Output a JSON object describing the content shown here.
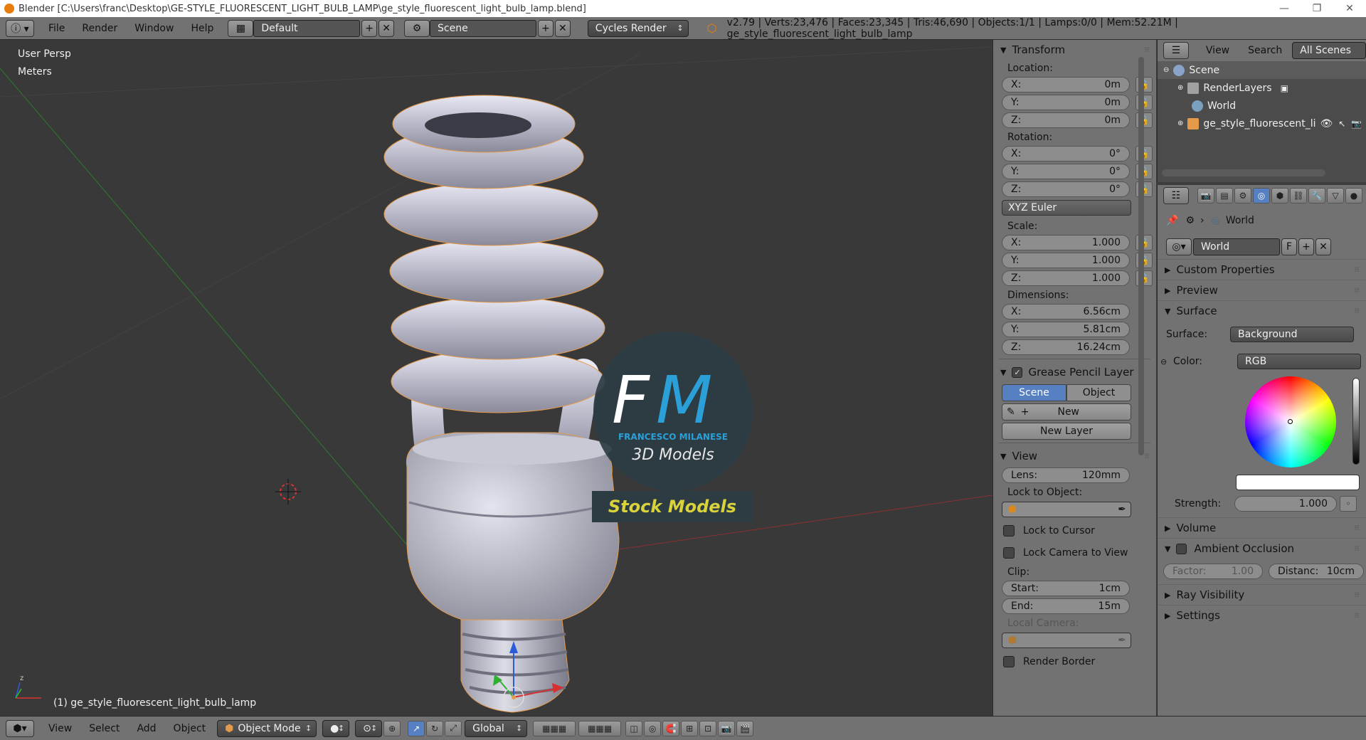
{
  "window": {
    "title": "Blender [C:\\Users\\franc\\Desktop\\GE-STYLE_FLUORESCENT_LIGHT_BULB_LAMP\\ge_style_fluorescent_light_bulb_lamp.blend]",
    "minimize": "—",
    "maximize": "❐",
    "close": "✕"
  },
  "topbar": {
    "menus": [
      "File",
      "Render",
      "Window",
      "Help"
    ],
    "layout": "Default",
    "scene": "Scene",
    "engine": "Cycles Render",
    "stats": "v2.79 | Verts:23,476 | Faces:23,345 | Tris:46,690 | Objects:1/1 | Lamps:0/0 | Mem:52.21M | ge_style_fluorescent_light_bulb_lamp"
  },
  "viewport": {
    "view_name": "User Persp",
    "units": "Meters",
    "object_label": "(1) ge_style_fluorescent_light_bulb_lamp",
    "watermark": {
      "initials": "FM",
      "author": "FRANCESCO MILANESE",
      "subtitle": "3D Models",
      "banner": "Stock Models"
    }
  },
  "npanel": {
    "transform_title": "Transform",
    "location_label": "Location:",
    "location": [
      {
        "axis": "X:",
        "value": "0m"
      },
      {
        "axis": "Y:",
        "value": "0m"
      },
      {
        "axis": "Z:",
        "value": "0m"
      }
    ],
    "rotation_label": "Rotation:",
    "rotation": [
      {
        "axis": "X:",
        "value": "0°"
      },
      {
        "axis": "Y:",
        "value": "0°"
      },
      {
        "axis": "Z:",
        "value": "0°"
      }
    ],
    "rotation_mode": "XYZ Euler",
    "scale_label": "Scale:",
    "scale": [
      {
        "axis": "X:",
        "value": "1.000"
      },
      {
        "axis": "Y:",
        "value": "1.000"
      },
      {
        "axis": "Z:",
        "value": "1.000"
      }
    ],
    "dimensions_label": "Dimensions:",
    "dimensions": [
      {
        "axis": "X:",
        "value": "6.56cm"
      },
      {
        "axis": "Y:",
        "value": "5.81cm"
      },
      {
        "axis": "Z:",
        "value": "16.24cm"
      }
    ],
    "grease_title": "Grease Pencil Layer",
    "grease_scene": "Scene",
    "grease_object": "Object",
    "grease_new": "New",
    "grease_new_layer": "New Layer",
    "view_title": "View",
    "lens_label": "Lens:",
    "lens_value": "120mm",
    "lock_to_object": "Lock to Object:",
    "lock_to_cursor": "Lock to Cursor",
    "lock_camera": "Lock Camera to View",
    "clip_label": "Clip:",
    "clip_start_label": "Start:",
    "clip_start": "1cm",
    "clip_end_label": "End:",
    "clip_end": "15m",
    "local_camera": "Local Camera:",
    "render_border": "Render Border"
  },
  "outliner": {
    "menus": [
      "View",
      "Search"
    ],
    "filter": "All Scenes",
    "items": [
      "Scene",
      "RenderLayers",
      "World",
      "ge_style_fluorescent_li"
    ]
  },
  "properties": {
    "breadcrumb": "World",
    "world_name": "World",
    "fake_user": "F",
    "sections": {
      "custom": "Custom Properties",
      "preview": "Preview",
      "surface": "Surface",
      "volume": "Volume",
      "ao": "Ambient Occlusion",
      "ray": "Ray Visibility",
      "settings": "Settings"
    },
    "surface_label": "Surface:",
    "surface_value": "Background",
    "color_label": "Color:",
    "color_mode": "RGB",
    "strength_label": "Strength:",
    "strength_value": "1.000",
    "factor_label": "Factor:",
    "factor_value": "1.00",
    "distance_label": "Distanc:",
    "distance_value": "10cm"
  },
  "bottombar": {
    "menus": [
      "View",
      "Select",
      "Add",
      "Object"
    ],
    "mode": "Object Mode",
    "orientation": "Global"
  },
  "colors": {
    "accent": "#5680c2",
    "watermark_blue": "#2a9fd8",
    "banner_yellow": "#d9d23a",
    "selection_outline": "#e8a040"
  }
}
